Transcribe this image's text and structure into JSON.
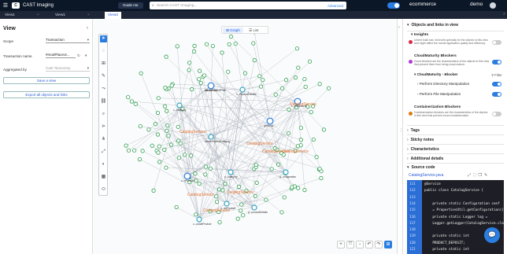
{
  "header": {
    "app_title": "CAST Imaging",
    "guide_label": "Guide me",
    "search_placeholder": "Search CAST Imaging...",
    "advanced_label": "Advanced",
    "project": "ecommerce",
    "user": "demo"
  },
  "tabs": [
    {
      "label": "View1"
    },
    {
      "label": "View1"
    },
    {
      "label": "View3"
    }
  ],
  "left_panel": {
    "title": "View",
    "scope_label": "Scope",
    "scope_value": "Transaction",
    "transaction_label": "Transaction name",
    "transaction_value": "#modPlaceor...",
    "aggregated_label": "Aggregated by",
    "aggregated_value": "Cast Taxonomy",
    "save_button": "Save a view",
    "export_button": "Export all objects and links"
  },
  "graph": {
    "view_graph": "Graph",
    "view_list": "List",
    "service_label": "CatalogService",
    "node_labels": [
      "placeOrder",
      "c...ProductDetails",
      "deleteProductCategory",
      "getStock",
      "p...category",
      "g...onfiguration",
      "c...eProduct",
      "c...category",
      "a...ddProduct",
      "c...productList",
      "g...productDetails",
      "u...pdateProduct",
      "deleteProductPrice"
    ]
  },
  "right_panel": {
    "objects_links": "Objects and links in view",
    "insights": "Insights",
    "insight1_desc": "Unmet build lost, held with optimally for the objects in this view and might affect the overall application quality and efficiency.",
    "cloud_blockers": "CloudMaturity Blockers",
    "cloud_blockers_desc": "Cloud blockers are the characteristics of the objects in this view that prevent them from being cloud-mature.",
    "cloud_blocker_item": "CloudMaturity - Blocker",
    "filter_label": "Filter",
    "perform_dir": "Perform Directory Manipulation",
    "perform_file": "Perform File Manipulation",
    "container_blockers": "Containerization Blockers",
    "container_desc": "Containerization blockers are the characteristics of the objects in this view that prevent cloud containerization.",
    "tags": "Tags",
    "sticky": "Sticky notes",
    "characteristics": "Characteristics",
    "additional": "Additional details",
    "source_code": "Source code",
    "file_name": "CatalogService.java",
    "colors": {
      "insight_dot": "#e0294a",
      "cloud_dot": "#b23ad6",
      "container_dot": "#e07a10"
    }
  },
  "code": {
    "lines": [
      {
        "n": "111",
        "t": "@Service"
      },
      {
        "n": "112",
        "t": "public class CatalogService {"
      },
      {
        "n": "113",
        "t": ""
      },
      {
        "n": "114",
        "t": "    private static Configuration conf"
      },
      {
        "n": "115",
        "t": "    = PropertiesUtil.getConfiguration();"
      },
      {
        "n": "116",
        "t": "    private static Logger log ="
      },
      {
        "n": "117",
        "t": "    Logger.getLogger(CatalogService.class"
      },
      {
        "n": "118",
        "t": ""
      },
      {
        "n": "119",
        "t": "    private static int"
      },
      {
        "n": "120",
        "t": "    PRODUCT_DEPOSIT;"
      },
      {
        "n": "121",
        "t": "    private static int"
      }
    ]
  }
}
